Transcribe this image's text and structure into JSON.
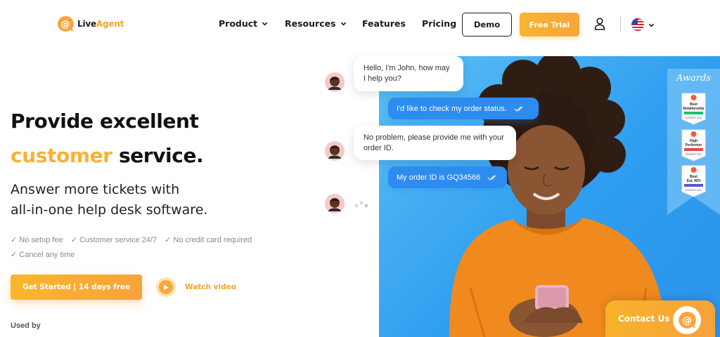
{
  "brand": {
    "name_part1": "Live",
    "name_part2": "Agent"
  },
  "nav": {
    "product": "Product",
    "resources": "Resources",
    "features": "Features",
    "pricing": "Pricing",
    "demo": "Demo",
    "free_trial": "Free Trial"
  },
  "hero": {
    "headline_line1": "Provide excellent",
    "headline_accent": "customer",
    "headline_rest": " service.",
    "sub_line1": "Answer more tickets with",
    "sub_line2": "all-in-one help desk software.",
    "features": [
      "✓ No setup fee",
      "✓ Customer service 24/7",
      "✓ No credit card required",
      "✓ Cancel any time"
    ],
    "cta": "Get Started | 14 days free",
    "watch_video": "Watch video",
    "used_by": "Used by"
  },
  "chat": {
    "msg1": "Hello, I'm John, how may I help you?",
    "reply1": "I'd like to check my order status.",
    "msg2": "No problem, please provide me with your order ID.",
    "reply2": "My order ID is GQ34566"
  },
  "awards": {
    "title": "Awards",
    "badges": [
      {
        "lines": [
          "Best",
          "Relationship"
        ],
        "tag": "SUMMER 2022"
      },
      {
        "lines": [
          "High",
          "Performer"
        ],
        "tag": "SUMMER 2022"
      },
      {
        "lines": [
          "Best",
          "Est. ROI"
        ],
        "tag": "SUMMER 2022"
      }
    ]
  },
  "contact": {
    "label": "Contact Us"
  },
  "colors": {
    "accent": "#f9b233",
    "primary_blue": "#2d8cf0",
    "photo_bg": "#3aa8f2"
  }
}
